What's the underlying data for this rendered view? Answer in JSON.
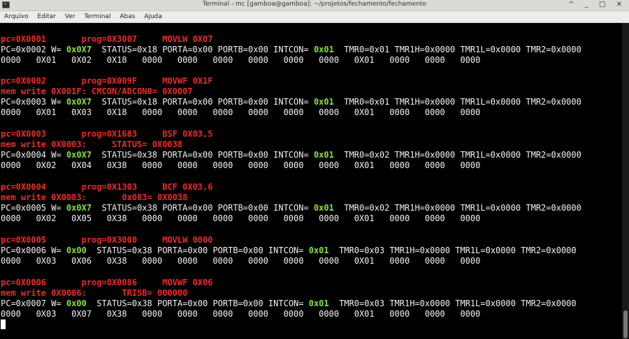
{
  "window": {
    "title": "Terminal - mc [gamboa@gamboa]: ~/projetos/fechamento/fechamento",
    "controls": "^ _ □ ✕"
  },
  "menu": [
    "Arquivo",
    "Editar",
    "Ver",
    "Terminal",
    "Abas",
    "Ajuda"
  ],
  "blocks": [
    {
      "header": [
        [
          "pc=0X0001",
          "       "
        ],
        [
          "prog=0X3007",
          "     "
        ],
        [
          "MOVLW 0X07",
          ""
        ]
      ],
      "mem": null,
      "regs": [
        "PC=0x0002 W= ",
        "0x0X7",
        "  STATUS=0x18 PORTA=0x00 PORTB=0x00 INTCON= ",
        "0x01",
        "  TMR0=0x01 TMR1H=0x0000 TMR1L=0x0000 TMR2=0x0000"
      ],
      "values": "0000   0X01   0X02   0X18   0000   0000   0000   0000   0000   0000   0X01   0000   0000   0000"
    },
    {
      "header": [
        [
          "pc=0X0002",
          "       "
        ],
        [
          "prog=0X009F",
          "     "
        ],
        [
          "MOVWF 0X1F",
          ""
        ]
      ],
      "mem": "mem write 0X001F: CMCON/ADCON0= 0X0007",
      "regs": [
        "PC=0x0003 W= ",
        "0x0X7",
        "  STATUS=0x18 PORTA=0x00 PORTB=0x00 INTCON= ",
        "0x01",
        "  TMR0=0x01 TMR1H=0x0000 TMR1L=0x0000 TMR2=0x0000"
      ],
      "values": "0000   0X01   0X03   0X18   0000   0000   0000   0000   0000   0000   0X01   0000   0000   0000"
    },
    {
      "header": [
        [
          "pc=0X0003",
          "       "
        ],
        [
          "prog=0X1683",
          "     "
        ],
        [
          "BSF 0X03,5",
          ""
        ]
      ],
      "mem": "mem write 0X0003:     STATUS= 0X0038",
      "regs": [
        "PC=0x0004 W= ",
        "0x0X7",
        "  STATUS=0x38 PORTA=0x00 PORTB=0x00 INTCON= ",
        "0x01",
        "  TMR0=0x02 TMR1H=0x0000 TMR1L=0x0000 TMR2=0x0000"
      ],
      "values": "0000   0X02   0X04   0X38   0000   0000   0000   0000   0000   0000   0X01   0000   0000   0000"
    },
    {
      "header": [
        [
          "pc=0X0004",
          "       "
        ],
        [
          "prog=0X1303",
          "     "
        ],
        [
          "BCF 0X03,6",
          ""
        ]
      ],
      "mem": "mem write 0X0083:       0x083= 0X0038",
      "regs": [
        "PC=0x0005 W= ",
        "0x0X7",
        "  STATUS=0x38 PORTA=0x00 PORTB=0x00 INTCON= ",
        "0x01",
        "  TMR0=0x02 TMR1H=0x0000 TMR1L=0x0000 TMR2=0x0000"
      ],
      "values": "0000   0X02   0X05   0X38   0000   0000   0000   0000   0000   0000   0X01   0000   0000   0000"
    },
    {
      "header": [
        [
          "pc=0X0005",
          "       "
        ],
        [
          "prog=0X3000",
          "     "
        ],
        [
          "MOVLW 0000",
          ""
        ]
      ],
      "mem": null,
      "regs": [
        "PC=0x0006 W= ",
        "0x00",
        "  STATUS=0x38 PORTA=0x00 PORTB=0x00 INTCON= ",
        "0x01",
        "  TMR0=0x03 TMR1H=0x0000 TMR1L=0x0000 TMR2=0x0000"
      ],
      "values": "0000   0X03   0X06   0X38   0000   0000   0000   0000   0000   0000   0X01   0000   0000   0000"
    },
    {
      "header": [
        [
          "pc=0X0006",
          "       "
        ],
        [
          "prog=0X0086",
          "     "
        ],
        [
          "MOVWF 0X06",
          ""
        ]
      ],
      "mem": "mem write 0X0086:       TRISB= 000000",
      "regs": [
        "PC=0x0007 W= ",
        "0x00",
        "  STATUS=0x38 PORTA=0x00 PORTB=0x00 INTCON= ",
        "0x01",
        "  TMR0=0x03 TMR1H=0x0000 TMR1L=0x0000 TMR2=0x0000"
      ],
      "values": "0000   0X03   0X07   0X38   0000   0000   0000   0000   0000   0000   0X01   0000   0000   0000"
    }
  ],
  "colors": {
    "text": "#f2f2f2",
    "accent_red": "#ef2929",
    "accent_green": "#8ae234",
    "background": "#000000"
  }
}
